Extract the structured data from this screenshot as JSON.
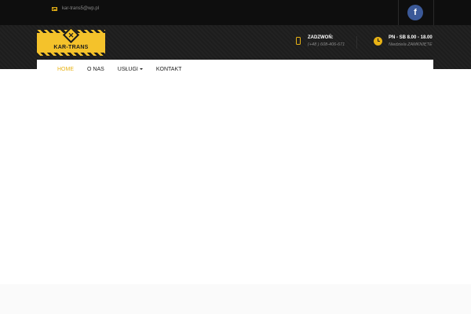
{
  "topbar": {
    "email": "kar-trans5@wp.pl",
    "email_icon": "envelope-icon",
    "social": {
      "facebook_glyph": "f",
      "facebook_color": "#3b5998"
    }
  },
  "logo": {
    "text": "KAR-TRANS",
    "icon": "hammer-wrench-icon",
    "brand_color": "#f4c22b"
  },
  "contacts": [
    {
      "icon": "phone-icon",
      "title": "ZADZWOŃ:",
      "sub": "(+48 ) 608-406-671"
    },
    {
      "icon": "clock-icon",
      "title": "PN - SB 8.00 - 18.00",
      "sub": "Niedziela ZAMKNIĘTE"
    }
  ],
  "nav": {
    "items": [
      {
        "label": "HOME",
        "active": true
      },
      {
        "label": "O NAS"
      },
      {
        "label": "USŁUGI",
        "dropdown": true
      },
      {
        "label": "KONTAKT"
      }
    ]
  },
  "colors": {
    "accent": "#e8b215",
    "dark": "#1d1d1d"
  }
}
